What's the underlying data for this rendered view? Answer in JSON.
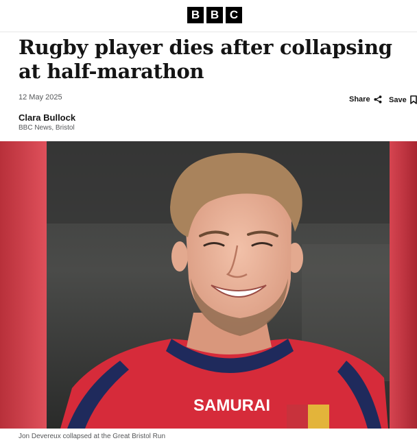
{
  "header": {
    "logo_letters": [
      "B",
      "B",
      "C"
    ]
  },
  "article": {
    "headline": "Rugby player dies after collapsing at half-marathon",
    "date": "12 May 2025",
    "share_label": "Share",
    "save_label": "Save",
    "author_name": "Clara Bullock",
    "author_org": "BBC News, Bristol",
    "image_caption": "Jon Devereux collapsed at the Great Bristol Run",
    "shirt_sponsor": "SAMURAI"
  },
  "icons": {
    "share": "share-icon",
    "save": "bookmark-icon"
  },
  "colors": {
    "text": "#141414",
    "meta": "#545658",
    "shirt_red": "#d62b3a",
    "shirt_navy": "#1f2a5c"
  }
}
